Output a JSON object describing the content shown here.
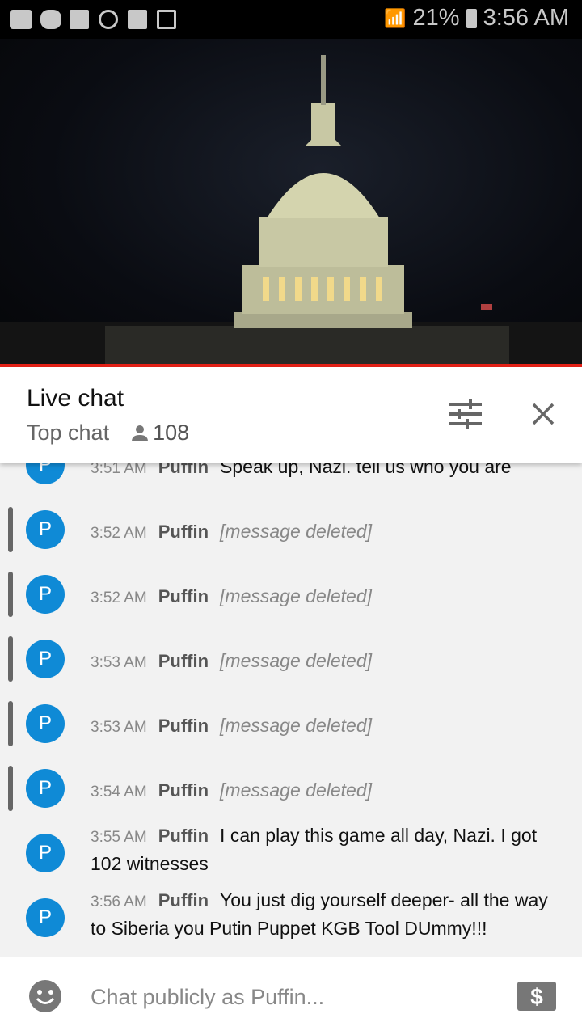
{
  "status_bar": {
    "battery": "21%",
    "time": "3:56 AM",
    "icons": [
      "youtube-icon",
      "m-app-icon",
      "folder-icon",
      "pinwheel-icon",
      "gallery-icon",
      "news-icon",
      "wifi-icon",
      "signal-icon",
      "battery-icon"
    ]
  },
  "header": {
    "title": "Live chat",
    "mode": "Top chat",
    "viewers": "108"
  },
  "messages": [
    {
      "time": "3:51 AM",
      "author": "Puffin",
      "text": "Speak up, Nazi. tell us who you are",
      "deleted": false
    },
    {
      "time": "3:52 AM",
      "author": "Puffin",
      "text": "[message deleted]",
      "deleted": true
    },
    {
      "time": "3:52 AM",
      "author": "Puffin",
      "text": "[message deleted]",
      "deleted": true
    },
    {
      "time": "3:53 AM",
      "author": "Puffin",
      "text": "[message deleted]",
      "deleted": true
    },
    {
      "time": "3:53 AM",
      "author": "Puffin",
      "text": "[message deleted]",
      "deleted": true
    },
    {
      "time": "3:54 AM",
      "author": "Puffin",
      "text": "[message deleted]",
      "deleted": true
    },
    {
      "time": "3:55 AM",
      "author": "Puffin",
      "text": "I can play this game all day, Nazi. I got 102 witnesses",
      "deleted": false
    },
    {
      "time": "3:56 AM",
      "author": "Puffin",
      "text": "You just dig yourself deeper- all the way to Siberia you Putin Puppet KGB Tool DUmmy!!!",
      "deleted": false
    }
  ],
  "avatar_letter": "P",
  "input": {
    "placeholder": "Chat publicly as Puffin..."
  },
  "colors": {
    "accent": "#e62117",
    "avatar": "#0f8ad6"
  }
}
